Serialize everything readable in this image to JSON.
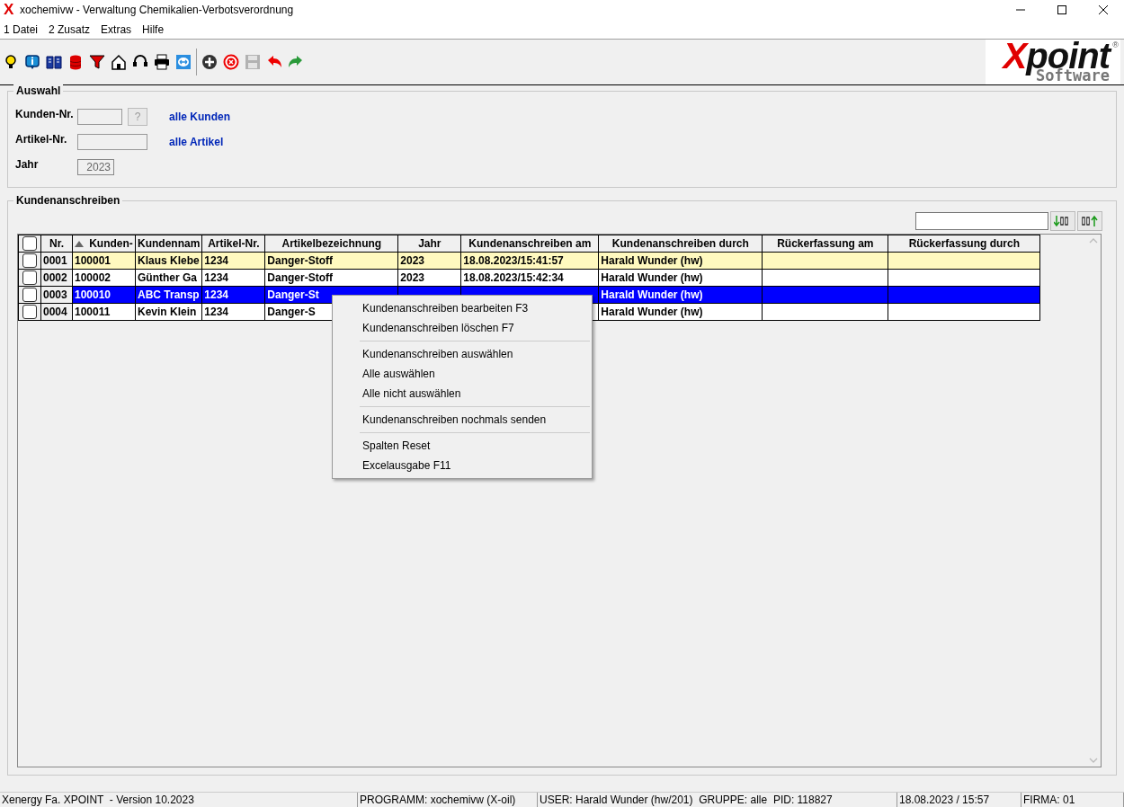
{
  "window": {
    "icon": "X",
    "title": "xochemivw - Verwaltung Chemikalien-Verbotsverordnung"
  },
  "menu": [
    "1 Datei",
    "2 Zusatz",
    "Extras",
    "Hilfe"
  ],
  "toolbar": [
    {
      "kind": "bulb"
    },
    {
      "kind": "info"
    },
    {
      "kind": "book"
    },
    {
      "kind": "stack"
    },
    {
      "kind": "funnel"
    },
    {
      "kind": "house"
    },
    {
      "kind": "headset"
    },
    {
      "kind": "printer"
    },
    {
      "kind": "link"
    },
    {
      "kind": "separator"
    },
    {
      "kind": "add"
    },
    {
      "kind": "delete"
    },
    {
      "kind": "save",
      "disabled": true
    },
    {
      "kind": "undo"
    },
    {
      "kind": "redo"
    }
  ],
  "logo": {
    "initial": "X",
    "rest": "point",
    "mark": "®",
    "sub": "Software"
  },
  "auswahl": {
    "title": "Auswahl",
    "fields": [
      {
        "label": "Kunden-Nr.",
        "kind": "lookup",
        "button": "?",
        "hint": "alle Kunden"
      },
      {
        "label": "Artikel-Nr.",
        "kind": "text",
        "hint": "alle Artikel"
      },
      {
        "label": "Jahr",
        "kind": "readonly",
        "value": "2023"
      }
    ]
  },
  "kundenanschreiben": {
    "title": "Kundenanschreiben",
    "select_all_checked": false,
    "columns": [
      {
        "label": "Nr."
      },
      {
        "label": "Kunden-",
        "sorted_ascending": true
      },
      {
        "label": "Kundennam"
      },
      {
        "label": "Artikel-Nr."
      },
      {
        "label": "Artikelbezeichnung"
      },
      {
        "label": "Jahr"
      },
      {
        "label": "Kundenanschreiben am"
      },
      {
        "label": "Kundenanschreiben durch"
      },
      {
        "label": "Rückerfassung am"
      },
      {
        "label": "Rückerfassung durch"
      }
    ],
    "rows": [
      {
        "checked": false,
        "selected": false,
        "highlighted": true,
        "cells": [
          "0001",
          "100001",
          "Klaus Klebe",
          "1234",
          "Danger-Stoff",
          "2023",
          "18.08.2023/15:41:57",
          "Harald Wunder (hw)",
          "",
          ""
        ]
      },
      {
        "checked": false,
        "selected": false,
        "highlighted": false,
        "cells": [
          "0002",
          "100002",
          "Günther Ga",
          "1234",
          "Danger-Stoff",
          "2023",
          "18.08.2023/15:42:34",
          "Harald Wunder (hw)",
          "",
          ""
        ]
      },
      {
        "checked": false,
        "selected": true,
        "highlighted": false,
        "cells": [
          "0003",
          "100010",
          "ABC Transp",
          "1234",
          "Danger-St",
          "",
          "",
          "Harald Wunder (hw)",
          "",
          ""
        ]
      },
      {
        "checked": false,
        "selected": false,
        "highlighted": false,
        "cells": [
          "0004",
          "100011",
          "Kevin Klein",
          "1234",
          "Danger-S",
          "",
          "",
          "Harald Wunder (hw)",
          "",
          ""
        ]
      }
    ]
  },
  "context_menu": [
    {
      "label": "Kundenanschreiben bearbeiten F3"
    },
    {
      "label": "Kundenanschreiben löschen F7"
    },
    {
      "kind": "separator"
    },
    {
      "label": "Kundenanschreiben auswählen"
    },
    {
      "label": "Alle auswählen"
    },
    {
      "label": "Alle nicht auswählen"
    },
    {
      "kind": "separator"
    },
    {
      "label": "Kundenanschreiben nochmals senden"
    },
    {
      "kind": "separator"
    },
    {
      "label": "Spalten Reset"
    },
    {
      "label": "Excelausgabe F11"
    }
  ],
  "status_bar": [
    "Xenergy Fa. XPOINT  - Version 10.2023",
    "PROGRAMM: xochemivw (X-oil)",
    "USER: Harald Wunder (hw/201)  GRUPPE: alle  PID: 118827",
    "18.08.2023 / 15:57",
    "FIRMA: 01"
  ]
}
